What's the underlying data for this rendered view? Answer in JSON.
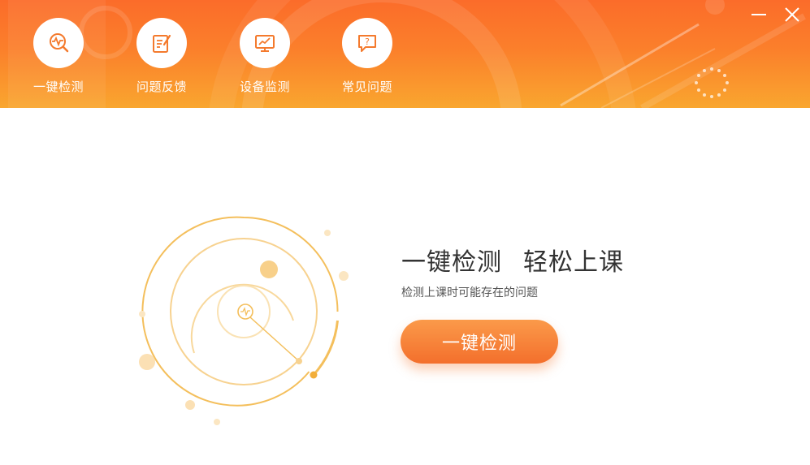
{
  "colors": {
    "header_top": "#fb6c2a",
    "header_bottom": "#f9a62f",
    "accent": "#f36f2c",
    "radar_ring": "#f5c46a"
  },
  "nav": {
    "items": [
      {
        "label": "一键检测",
        "icon": "pulse-search-icon"
      },
      {
        "label": "问题反馈",
        "icon": "edit-form-icon"
      },
      {
        "label": "设备监测",
        "icon": "monitor-chart-icon"
      },
      {
        "label": "常见问题",
        "icon": "question-chat-icon"
      }
    ]
  },
  "window": {
    "minimize_icon": "minimize-icon",
    "close_icon": "close-icon"
  },
  "main": {
    "title_part1": "一键检测",
    "title_part2": "轻松上课",
    "subtitle": "检测上课时可能存在的问题",
    "cta_label": "一键检测"
  }
}
